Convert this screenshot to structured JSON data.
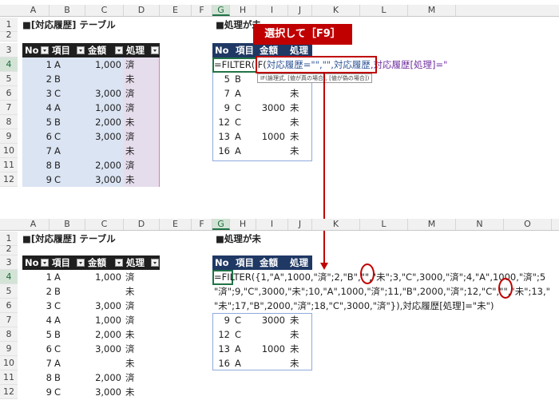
{
  "columns": [
    "A",
    "B",
    "C",
    "D",
    "E",
    "F",
    "G",
    "H",
    "I",
    "J",
    "K",
    "L",
    "M",
    "N",
    "O"
  ],
  "rows": [
    "1",
    "2",
    "3",
    "4",
    "5",
    "6",
    "7",
    "8",
    "9",
    "10",
    "11",
    "12"
  ],
  "top": {
    "table_title": "■[対応履歴] テーブル",
    "filter_title": "■処理が未",
    "headers": {
      "no": "No",
      "item": "項目",
      "amount": "金額",
      "status": "処理"
    },
    "table_rows": [
      {
        "no": "1",
        "item": "A",
        "amount": "1,000",
        "status": "済"
      },
      {
        "no": "2",
        "item": "B",
        "amount": "",
        "status": "未"
      },
      {
        "no": "3",
        "item": "C",
        "amount": "3,000",
        "status": "済"
      },
      {
        "no": "4",
        "item": "A",
        "amount": "1,000",
        "status": "済"
      },
      {
        "no": "5",
        "item": "B",
        "amount": "2,000",
        "status": "未"
      },
      {
        "no": "6",
        "item": "C",
        "amount": "3,000",
        "status": "済"
      },
      {
        "no": "7",
        "item": "A",
        "amount": "",
        "status": "未"
      },
      {
        "no": "8",
        "item": "B",
        "amount": "2,000",
        "status": "済"
      },
      {
        "no": "9",
        "item": "C",
        "amount": "3,000",
        "status": "未"
      }
    ],
    "formula_parts": {
      "p1": "=FILTER(",
      "p2": "IF(",
      "p3": "対応履歴=\"\"",
      "p4": ",\"\",",
      "p5": "対応履歴",
      "p6": ",対応履歴[処理]=\""
    },
    "tooltip": "IF(論理式, [値が真の場合], [値が偽の場合])",
    "callout": "選択して［F9］",
    "filter_rows": [
      {
        "no": "5",
        "item": "B",
        "amount": "",
        "status": ""
      },
      {
        "no": "7",
        "item": "A",
        "amount": "",
        "status": "未"
      },
      {
        "no": "9",
        "item": "C",
        "amount": "3000",
        "status": "未"
      },
      {
        "no": "12",
        "item": "C",
        "amount": "",
        "status": "未"
      },
      {
        "no": "13",
        "item": "A",
        "amount": "1000",
        "status": "未"
      },
      {
        "no": "16",
        "item": "A",
        "amount": "",
        "status": "未"
      }
    ]
  },
  "bottom": {
    "table_title": "■[対応履歴] テーブル",
    "filter_title": "■処理が未",
    "headers": {
      "no": "No",
      "item": "項目",
      "amount": "金額",
      "status": "処理"
    },
    "table_rows": [
      {
        "no": "1",
        "item": "A",
        "amount": "1,000",
        "status": "済"
      },
      {
        "no": "2",
        "item": "B",
        "amount": "",
        "status": "未"
      },
      {
        "no": "3",
        "item": "C",
        "amount": "3,000",
        "status": "済"
      },
      {
        "no": "4",
        "item": "A",
        "amount": "1,000",
        "status": "済"
      },
      {
        "no": "5",
        "item": "B",
        "amount": "2,000",
        "status": "未"
      },
      {
        "no": "6",
        "item": "C",
        "amount": "3,000",
        "status": "済"
      },
      {
        "no": "7",
        "item": "A",
        "amount": "",
        "status": "未"
      },
      {
        "no": "8",
        "item": "B",
        "amount": "2,000",
        "status": "済"
      },
      {
        "no": "9",
        "item": "C",
        "amount": "3,000",
        "status": "未"
      }
    ],
    "formula_line1": "=FILTER({1,\"A\",1000,\"済\";2,\"B\",\"\",\"未\";3,\"C\",3000,\"済\";4,\"A\",1000,\"済\";5",
    "formula_line2": "\"済\";9,\"C\",3000,\"未\";10,\"A\",1000,\"済\";11,\"B\",2000,\"済\";12,\"C\",\"\",\"未\";13,\"",
    "formula_line3": "\"未\";17,\"B\",2000,\"済\";18,\"C\",3000,\"済\"}),対応履歴[処理]=\"未\")",
    "filter_rows": [
      {
        "no": "9",
        "item": "C",
        "amount": "3000",
        "status": "未"
      },
      {
        "no": "12",
        "item": "C",
        "amount": "",
        "status": "未"
      },
      {
        "no": "13",
        "item": "A",
        "amount": "1000",
        "status": "未"
      },
      {
        "no": "16",
        "item": "A",
        "amount": "",
        "status": "未"
      }
    ]
  },
  "colors": {
    "accent_red": "#c00000",
    "table_blue": "#dbe4f3",
    "table_purple": "#e5dcec",
    "header_dark": "#1f1f1f",
    "excel_green": "#217346"
  }
}
